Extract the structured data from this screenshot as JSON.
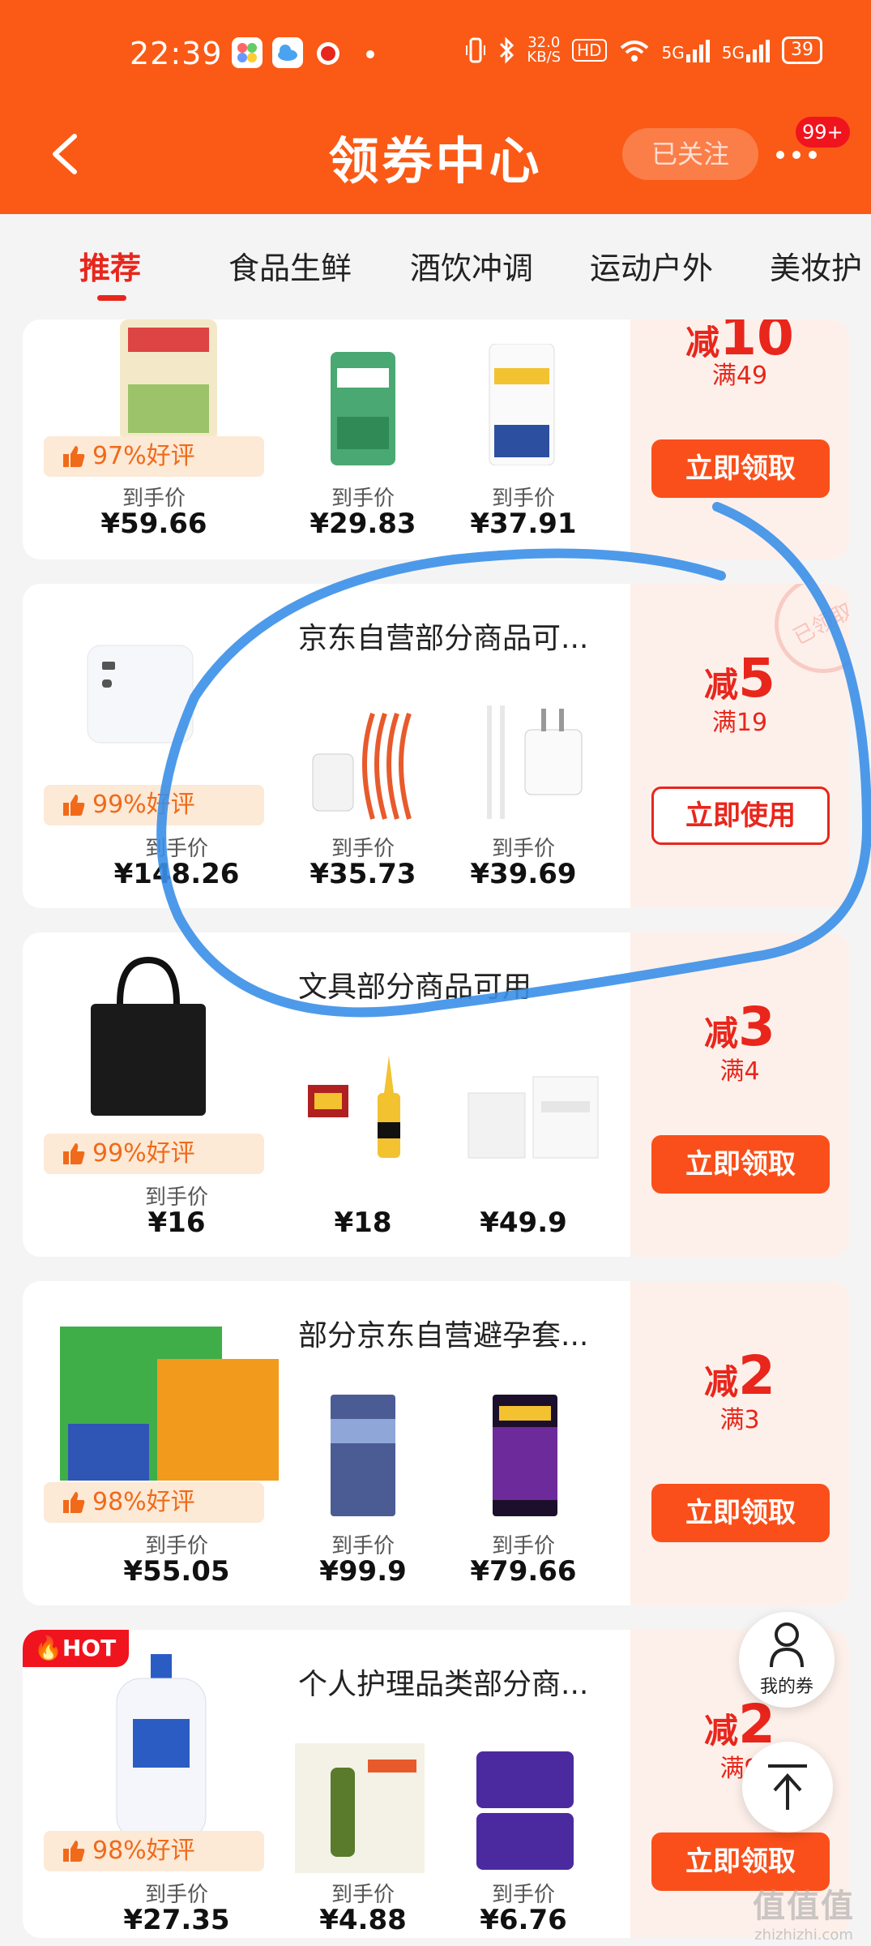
{
  "status_bar": {
    "time": "22:39",
    "speed_value": "32.0",
    "speed_unit": "KB/S",
    "hd": "HD",
    "net1": "5G",
    "net2": "5G",
    "battery": "39"
  },
  "header": {
    "title": "领券中心",
    "follow_label": "已关注",
    "badge": "99+"
  },
  "tabs": [
    {
      "label": "推荐",
      "active": true
    },
    {
      "label": "食品生鲜"
    },
    {
      "label": "酒饮冲调"
    },
    {
      "label": "运动户外"
    },
    {
      "label": "美妆护"
    }
  ],
  "coupons": [
    {
      "rating": "97%好评",
      "products": [
        {
          "caption": "到手价",
          "price": "¥59.66"
        },
        {
          "caption": "到手价",
          "price": "¥29.83"
        },
        {
          "caption": "到手价",
          "price": "¥37.91"
        }
      ],
      "discount_prefix": "减",
      "discount_value": "10",
      "threshold": "满49",
      "button": "立即领取"
    },
    {
      "title": "京东自营部分商品可...",
      "rating": "99%好评",
      "products": [
        {
          "caption": "到手价",
          "price": "¥148.26"
        },
        {
          "caption": "到手价",
          "price": "¥35.73"
        },
        {
          "caption": "到手价",
          "price": "¥39.69"
        }
      ],
      "discount_prefix": "减",
      "discount_value": "5",
      "threshold": "满19",
      "button": "立即使用",
      "stamp": "已领取"
    },
    {
      "title": "文具部分商品可用",
      "rating": "99%好评",
      "products": [
        {
          "caption": "到手价",
          "price": "¥16"
        },
        {
          "caption": "",
          "price": "¥18"
        },
        {
          "caption": "",
          "price": "¥49.9"
        }
      ],
      "discount_prefix": "减",
      "discount_value": "3",
      "threshold": "满4",
      "button": "立即领取"
    },
    {
      "title": "部分京东自营避孕套...",
      "rating": "98%好评",
      "products": [
        {
          "caption": "到手价",
          "price": "¥55.05"
        },
        {
          "caption": "到手价",
          "price": "¥99.9"
        },
        {
          "caption": "到手价",
          "price": "¥79.66"
        }
      ],
      "discount_prefix": "减",
      "discount_value": "2",
      "threshold": "满3",
      "button": "立即领取"
    },
    {
      "hot": "HOT",
      "title": "个人护理品类部分商...",
      "rating": "98%好评",
      "products": [
        {
          "caption": "到手价",
          "price": "¥27.35"
        },
        {
          "caption": "到手价",
          "price": "¥4.88"
        },
        {
          "caption": "到手价",
          "price": "¥6.76"
        }
      ],
      "discount_prefix": "减",
      "discount_value": "2",
      "threshold": "满9",
      "button": "立即领取"
    }
  ],
  "float": {
    "my_coupons": "我的券"
  },
  "watermark": {
    "main": "值值值",
    "sub": "zhizhizhi.com"
  },
  "colors": {
    "header": "#fa5a16",
    "accent": "#e8261c",
    "button": "#fa4f1a",
    "rating_bg": "#fce9d6",
    "coupon_panel": "#fdf0ea"
  }
}
